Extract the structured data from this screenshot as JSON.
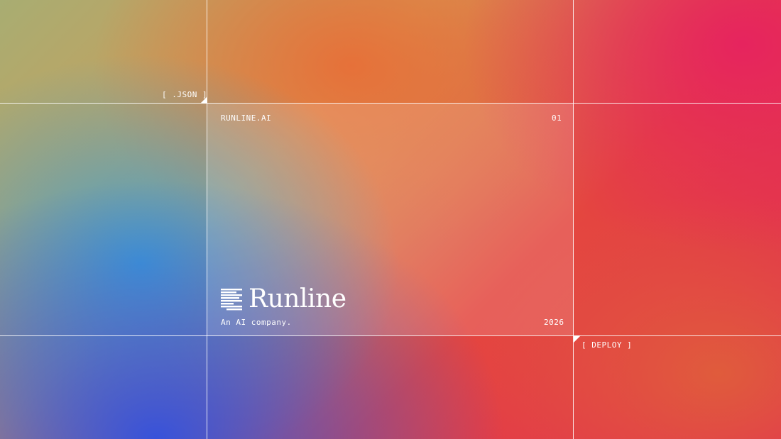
{
  "slide": {
    "tag_top_left": "[ .JSON ]",
    "tag_bottom_right": "[ DEPLOY ]",
    "brand_small": "RUNLINE.AI",
    "slide_number": "01",
    "logo_icon": "striped-lines-icon",
    "logo_text": "Runline",
    "tagline": "An AI company.",
    "year": "2026"
  },
  "colors": {
    "blue": "#3050E1",
    "cyan": "#3AA2D6",
    "orange": "#E86C36",
    "red": "#E4463F",
    "pink": "#E22A55",
    "line": "#FFFFFF"
  }
}
